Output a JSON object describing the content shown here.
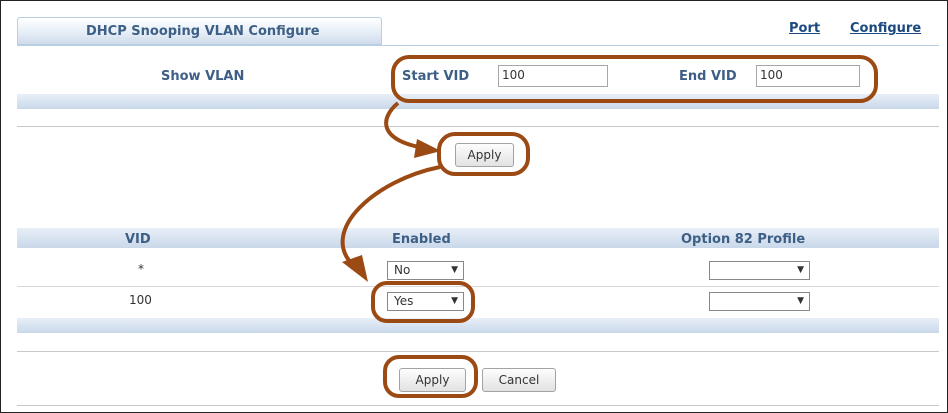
{
  "header": {
    "tab_title": "DHCP Snooping VLAN Configure",
    "link_port": "Port",
    "link_configure": "Configure"
  },
  "show_vlan": {
    "label": "Show VLAN",
    "start_vid_label": "Start VID",
    "start_vid_value": "100",
    "end_vid_label": "End VID",
    "end_vid_value": "100",
    "apply_label": "Apply"
  },
  "table": {
    "columns": [
      "VID",
      "Enabled",
      "Option 82 Profile"
    ],
    "rows": [
      {
        "vid": "*",
        "enabled": "No",
        "profile": ""
      },
      {
        "vid": "100",
        "enabled": "Yes",
        "profile": ""
      }
    ]
  },
  "footer": {
    "apply_label": "Apply",
    "cancel_label": "Cancel"
  },
  "colors": {
    "highlight": "#9c4a14",
    "header_text": "#3d5f86",
    "link": "#1b4a80"
  },
  "icons": [
    "dropdown-arrow-icon",
    "annotation-arrow"
  ]
}
